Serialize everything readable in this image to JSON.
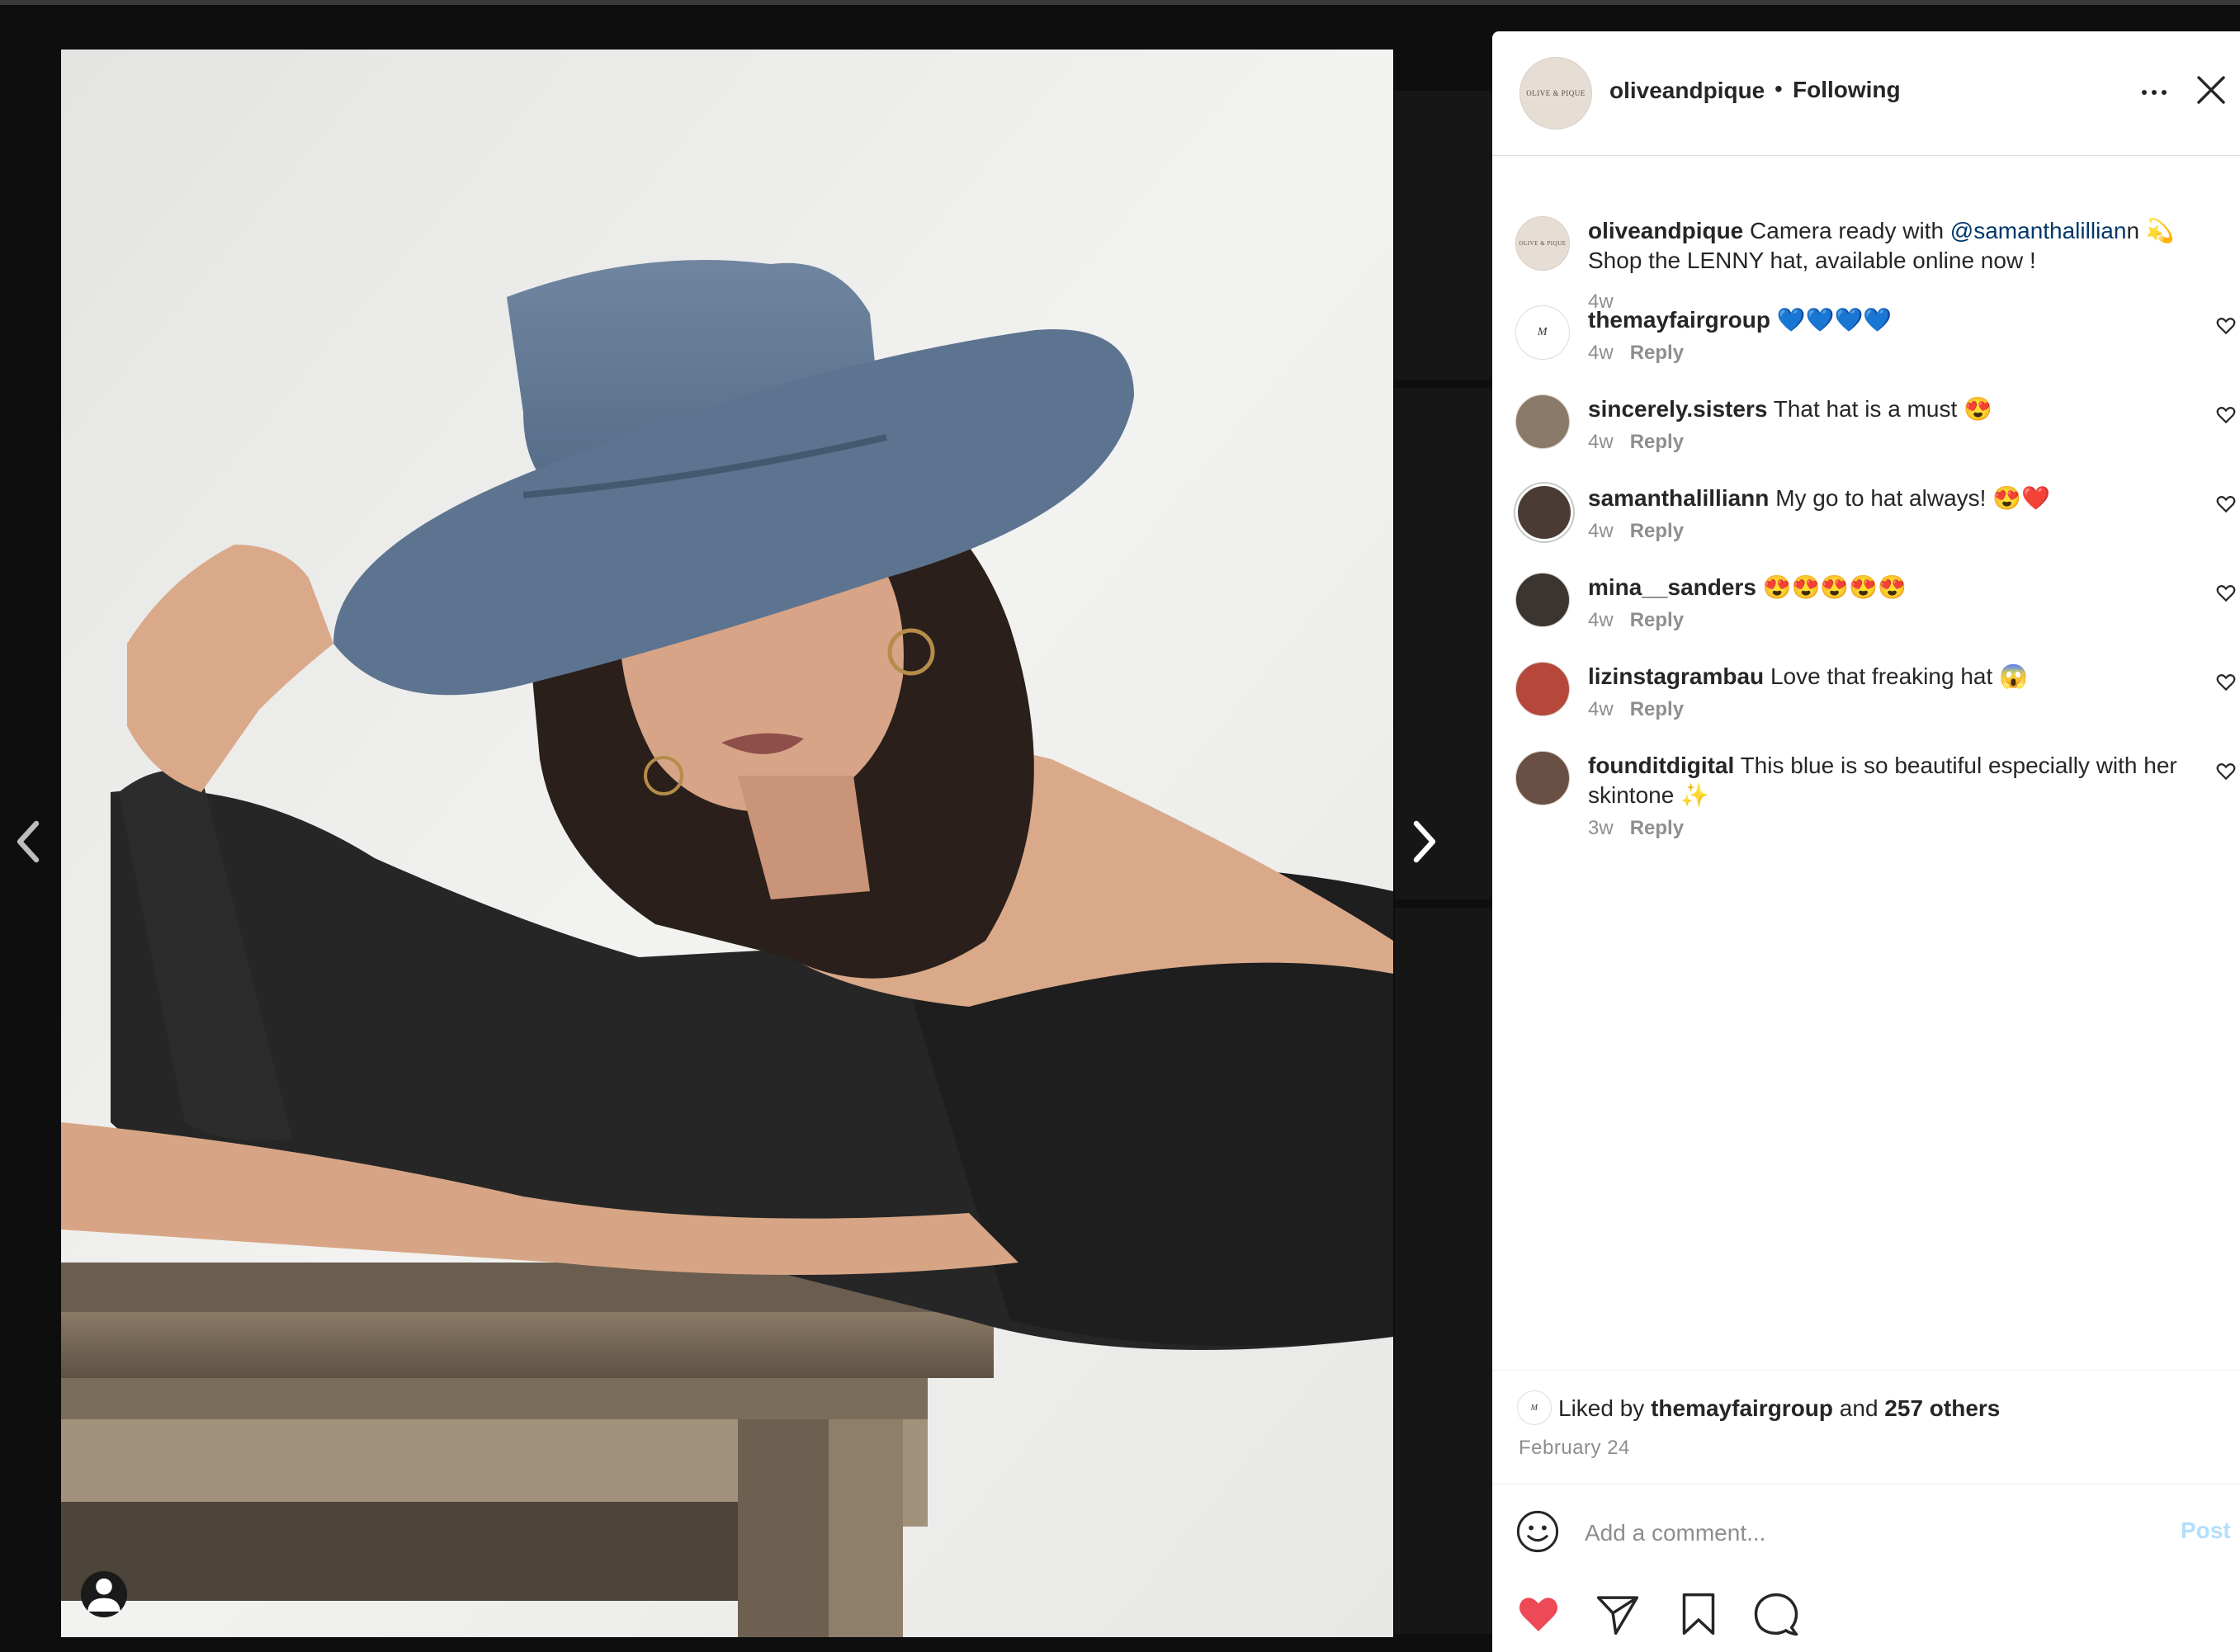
{
  "post": {
    "username": "oliveandpique",
    "avatar_text": "OLIVE & PIQUE",
    "follow_status": "Following",
    "separator": "•"
  },
  "caption": {
    "username": "oliveandpique",
    "text_before": "Camera ready with ",
    "mention": "@samanthalillian",
    "text_after": "n 💫",
    "line2": "Shop the LENNY hat, available online now !",
    "time": "4w"
  },
  "comments": [
    {
      "username": "themayfairgroup",
      "text": "💙💙💙💙",
      "time": "4w",
      "reply": "Reply"
    },
    {
      "username": "sincerely.sisters",
      "text": "That hat is a must 😍",
      "time": "4w",
      "reply": "Reply"
    },
    {
      "username": "samanthalilliann",
      "text": "My go to hat always! 😍❤️",
      "time": "4w",
      "reply": "Reply"
    },
    {
      "username": "mina__sanders",
      "text": "😍😍😍😍😍",
      "time": "4w",
      "reply": "Reply"
    },
    {
      "username": "lizinstagrambau",
      "text": "Love that freaking hat 😱",
      "time": "4w",
      "reply": "Reply"
    },
    {
      "username": "founditdigital",
      "text": "This blue is so beautiful especially with her skintone ✨",
      "time": "3w",
      "reply": "Reply"
    }
  ],
  "likes": {
    "prefix": "Liked by ",
    "user": "themayfairgroup",
    "middle": " and ",
    "others": "257 others",
    "date": "February 24"
  },
  "comment_box": {
    "placeholder": "Add a comment...",
    "post_label": "Post"
  },
  "colors": {
    "like_red": "#ed4956",
    "post_disabled": "#b2dffc",
    "mention_blue": "#00376b",
    "secondary_text": "#8e8e8e"
  },
  "icons": [
    "chevron-left-icon",
    "chevron-right-icon",
    "user-tag-icon",
    "more-icon",
    "close-icon",
    "heart-icon",
    "emoji-icon",
    "share-icon",
    "bookmark-icon",
    "comment-icon"
  ]
}
